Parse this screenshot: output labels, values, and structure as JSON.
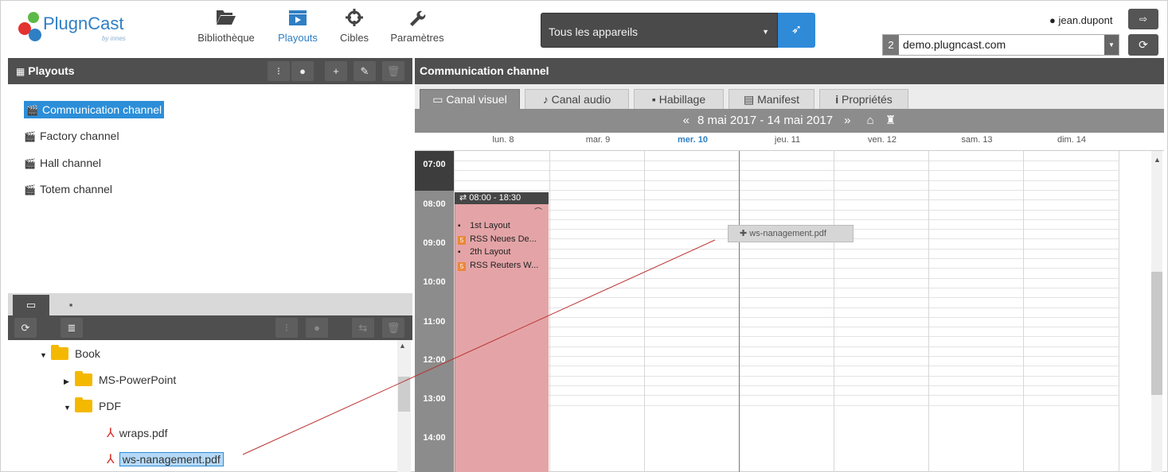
{
  "app": {
    "logo_text": "PlugnCast",
    "logo_sub": "by innes",
    "colors": {
      "accent": "#2f7fc4",
      "dark": "#4f4f4f",
      "event": "#e4a4a7",
      "selected": "#2c8ed8"
    }
  },
  "nav": {
    "items": [
      {
        "label": "Bibliothèque",
        "icon": "folder-open-icon"
      },
      {
        "label": "Playouts",
        "icon": "film-icon",
        "active": true
      },
      {
        "label": "Cibles",
        "icon": "crosshair-icon"
      },
      {
        "label": "Paramètres",
        "icon": "wrench-icon"
      }
    ]
  },
  "device_select": {
    "value": "Tous les appareils"
  },
  "user": {
    "name": "jean.dupont"
  },
  "domain": {
    "number": "2",
    "value": "demo.plugncast.com"
  },
  "playouts_panel": {
    "title": "Playouts",
    "items": [
      {
        "label": "Communication channel",
        "selected": true
      },
      {
        "label": "Factory channel"
      },
      {
        "label": "Hall channel"
      },
      {
        "label": "Totem channel"
      }
    ]
  },
  "library_tree": {
    "root": "Book",
    "children": [
      {
        "label": "MS-PowerPoint",
        "expanded": false
      },
      {
        "label": "PDF",
        "expanded": true
      }
    ],
    "files": [
      {
        "label": "wraps.pdf"
      },
      {
        "label": "ws-nanagement.pdf",
        "selected": true
      }
    ]
  },
  "channel": {
    "title": "Communication channel",
    "tabs": [
      {
        "label": "Canal visuel",
        "active": true
      },
      {
        "label": "Canal audio"
      },
      {
        "label": "Habillage"
      },
      {
        "label": "Manifest"
      },
      {
        "label": "Propriétés"
      }
    ],
    "week_range": "8 mai 2017 - 14 mai 2017",
    "days": [
      "lun. 8",
      "mar. 9",
      "mer. 10",
      "jeu. 11",
      "ven. 12",
      "sam. 13",
      "dim. 14"
    ],
    "today": "mer. 10",
    "hours": [
      "07:00",
      "08:00",
      "09:00",
      "10:00",
      "11:00",
      "12:00",
      "13:00",
      "14:00"
    ]
  },
  "event": {
    "time": "08:00 - 18:30",
    "items": [
      {
        "label": "1st Layout",
        "type": "layout"
      },
      {
        "label": "RSS Neues De...",
        "type": "rss"
      },
      {
        "label": "2th Layout",
        "type": "layout"
      },
      {
        "label": "RSS Reuters W...",
        "type": "rss"
      }
    ]
  },
  "drag_chip": {
    "label": "ws-nanagement.pdf"
  }
}
